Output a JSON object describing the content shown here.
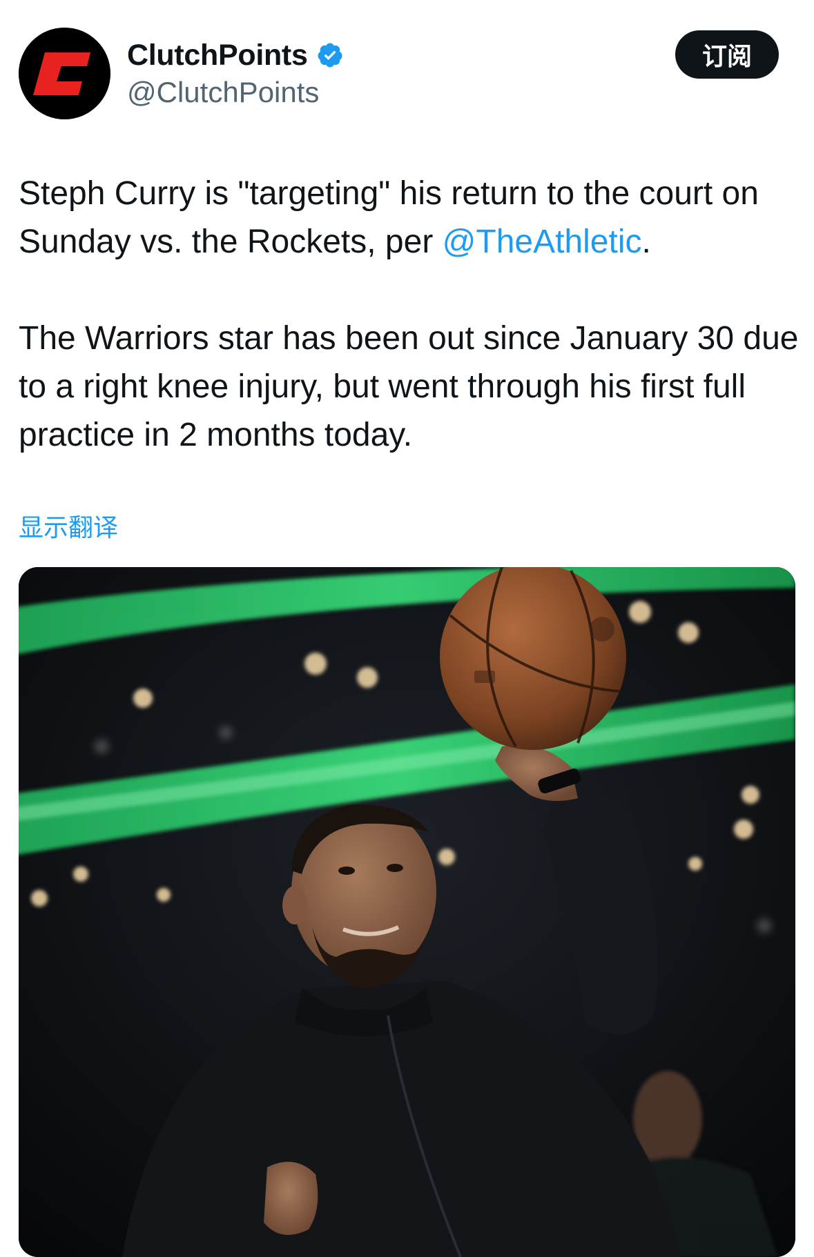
{
  "author": {
    "display_name": "ClutchPoints",
    "handle": "@ClutchPoints",
    "avatar_icon": "clutchpoints-c-logo",
    "verified": true,
    "verified_color": "#1d9bf0",
    "brand_color": "#e8231f"
  },
  "subscribe_button": {
    "label": "订阅"
  },
  "tweet": {
    "line1_text": "Steph Curry is \"targeting\" his return to the court on Sunday vs. the Rockets, per ",
    "mention": "@TheAthletic",
    "line1_end": ".",
    "paragraph2": "The Warriors star has been out since January 30 due to a right knee injury, but went through his first full practice in 2 months today."
  },
  "translate_link": "显示翻译",
  "media": {
    "type": "photo",
    "subject": "basketball-player-photo"
  },
  "colors": {
    "text": "#0f1419",
    "secondary_text": "#536471",
    "link": "#1d9bf0",
    "button_bg": "#0f1419"
  }
}
